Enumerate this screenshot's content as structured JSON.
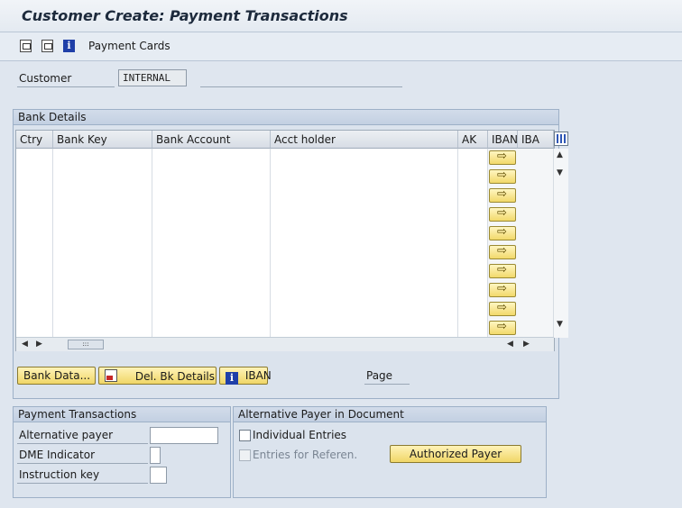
{
  "window": {
    "title": "Customer Create: Payment Transactions"
  },
  "toolbar": {
    "icons": [
      "previous-screen-icon",
      "next-screen-icon",
      "info-icon"
    ],
    "payment_cards_label": "Payment Cards"
  },
  "customer": {
    "label": "Customer",
    "value": "INTERNAL"
  },
  "bank_details": {
    "title": "Bank Details",
    "columns": [
      "Ctry",
      "Bank Key",
      "Bank Account",
      "Acct holder",
      "AK",
      "IBAN",
      "IBA"
    ],
    "row_count": 10,
    "buttons": {
      "bank_data": "Bank Data...",
      "del_bk_details": "Del. Bk Details",
      "iban": "IBAN"
    },
    "page_label": "Page"
  },
  "payment_transactions": {
    "title": "Payment Transactions",
    "alternative_payer": "Alternative payer",
    "dme_indicator": "DME Indicator",
    "instruction_key": "Instruction key"
  },
  "alt_payer_doc": {
    "title": "Alternative Payer in Document",
    "individual_entries": "Individual Entries",
    "entries_for_referen": "Entries for Referen.",
    "authorized_payer_button": "Authorized Payer"
  }
}
